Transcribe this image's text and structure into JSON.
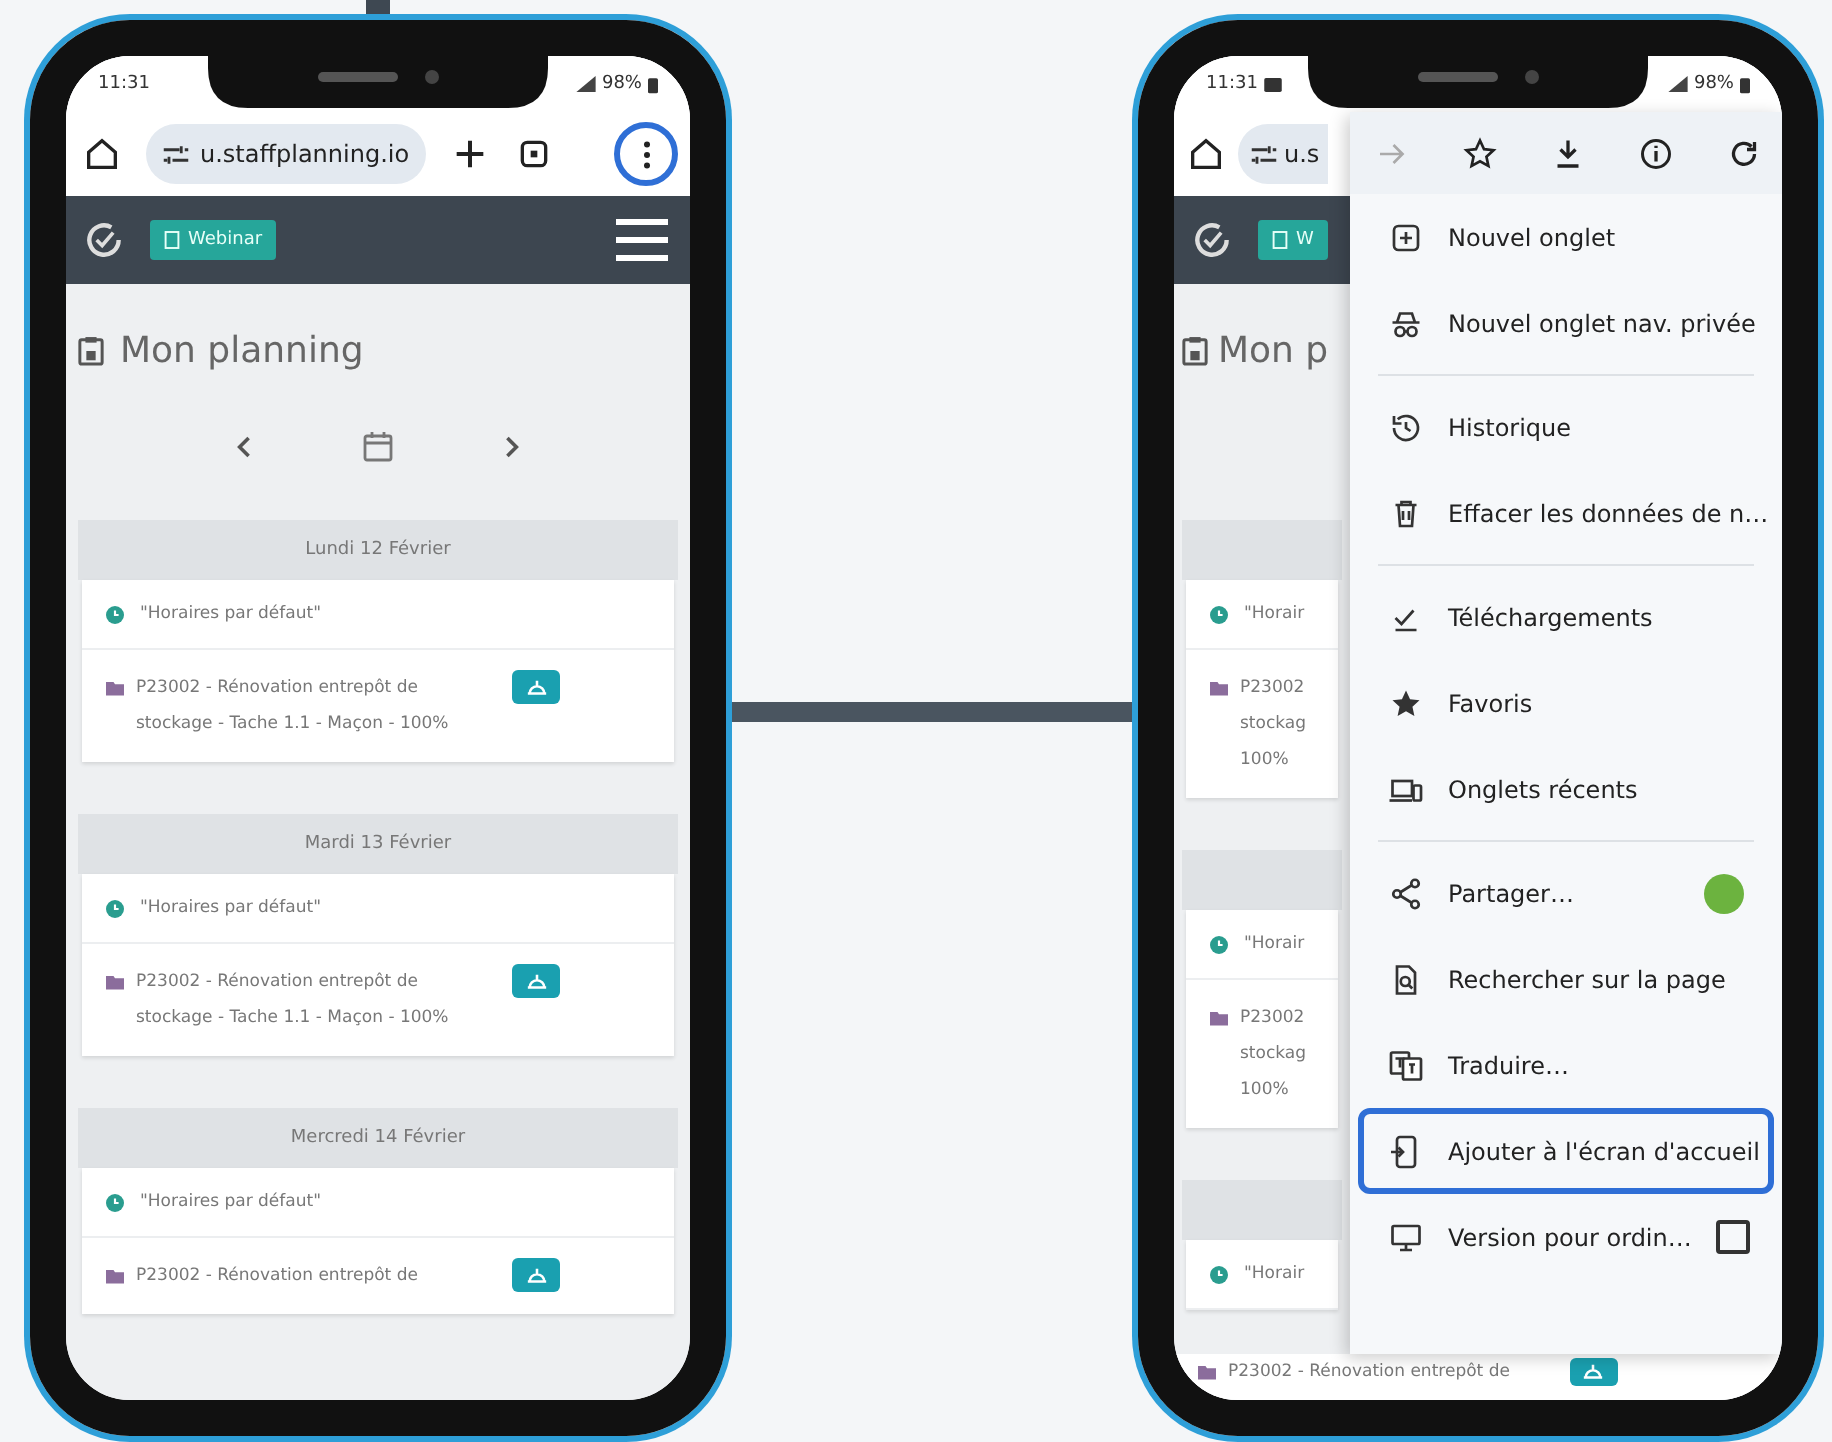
{
  "left_phone": {
    "status_bar": {
      "time": "11:31",
      "battery": "98%"
    },
    "browser_toolbar": {
      "url": "u.staffplanning.io",
      "menu_button_highlighted": true
    },
    "app_header": {
      "webinar_button": "Webinar"
    },
    "page_title": "Mon planning",
    "days": [
      {
        "label": "Lundi 12 Février",
        "entries": [
          {
            "kind": "schedule",
            "text": "\"Horaires par défaut\""
          },
          {
            "kind": "task",
            "text": "P23002 - Rénovation entrepôt de stockage - Tache 1.1 - Maçon - 100%"
          }
        ]
      },
      {
        "label": "Mardi 13 Février",
        "entries": [
          {
            "kind": "schedule",
            "text": "\"Horaires par défaut\""
          },
          {
            "kind": "task",
            "text": "P23002 - Rénovation entrepôt de stockage - Tache 1.1 - Maçon - 100%"
          }
        ]
      },
      {
        "label": "Mercredi 14 Février",
        "entries": [
          {
            "kind": "schedule",
            "text": "\"Horaires par défaut\""
          },
          {
            "kind": "task",
            "text": "P23002 - Rénovation entrepôt de"
          }
        ]
      }
    ]
  },
  "right_phone": {
    "status_bar": {
      "time": "11:31",
      "battery": "98%"
    },
    "browser_toolbar": {
      "url": "u.s"
    },
    "app_header": {
      "webinar_button": "W"
    },
    "page_title": "Mon p",
    "days": [
      {
        "entries": [
          {
            "kind": "schedule",
            "text": "\"Horair"
          },
          {
            "kind": "task",
            "text": "P23002\nstockag\n100%"
          }
        ]
      },
      {
        "entries": [
          {
            "kind": "schedule",
            "text": "\"Horair"
          },
          {
            "kind": "task",
            "text": "P23002\nstockag\n100%"
          }
        ]
      },
      {
        "entries": [
          {
            "kind": "schedule",
            "text": "\"Horair"
          }
        ]
      }
    ],
    "bottom_row": {
      "text": "P23002 - Rénovation entrepôt de"
    },
    "menu": {
      "groups": [
        {
          "items": [
            {
              "kind": "link",
              "label": "Nouvel onglet",
              "highlighted": false
            },
            {
              "kind": "link",
              "label": "Nouvel onglet nav. privée",
              "highlighted": false
            }
          ]
        },
        {
          "items": [
            {
              "kind": "link",
              "label": "Historique",
              "highlighted": false
            },
            {
              "kind": "link",
              "label": "Effacer les données de n…",
              "highlighted": false
            }
          ]
        },
        {
          "items": [
            {
              "kind": "link",
              "label": "Téléchargements",
              "highlighted": false
            },
            {
              "kind": "link",
              "label": "Favoris",
              "highlighted": false
            },
            {
              "kind": "link",
              "label": "Onglets récents",
              "highlighted": false
            }
          ]
        },
        {
          "items": [
            {
              "kind": "app",
              "label": "Partager…",
              "highlighted": false
            },
            {
              "kind": "link",
              "label": "Rechercher sur la page",
              "highlighted": false
            },
            {
              "kind": "link",
              "label": "Traduire…",
              "highlighted": false
            },
            {
              "kind": "link",
              "label": "Ajouter à l'écran d'accueil",
              "highlighted": true
            },
            {
              "kind": "checkbox",
              "label": "Version pour ordin…",
              "highlighted": false,
              "checked": false
            }
          ]
        }
      ]
    }
  }
}
